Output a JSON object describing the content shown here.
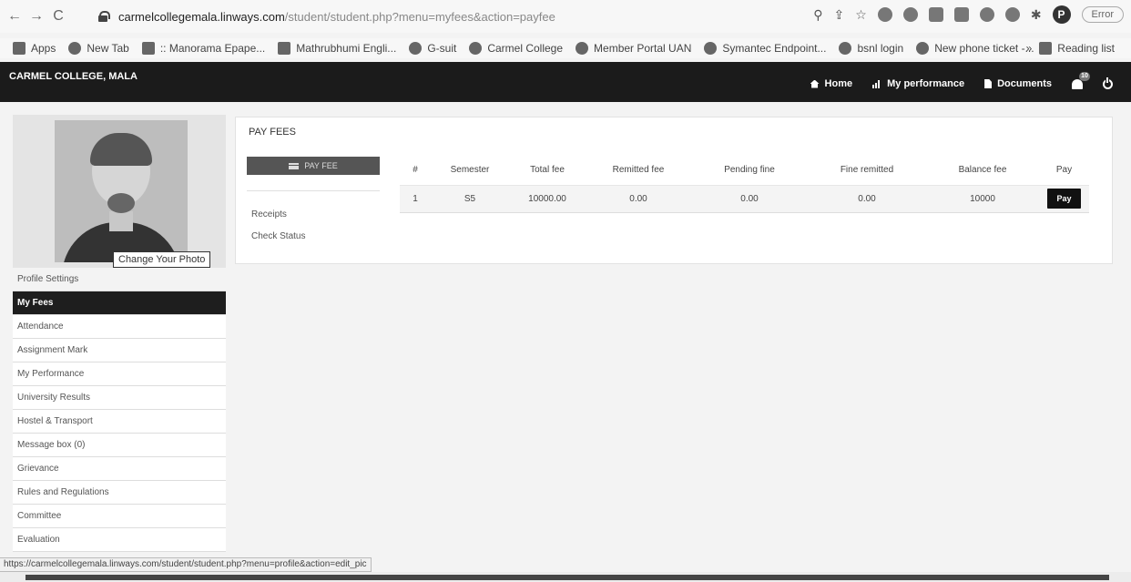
{
  "browser": {
    "url_host": "carmelcollegemala.linways.com",
    "url_path": "/student/student.php?menu=myfees&action=payfee",
    "profile_initial": "P",
    "error_label": "Error",
    "bookmarks": [
      {
        "label": "Apps",
        "icon": "apps-grid-icon"
      },
      {
        "label": "New Tab",
        "icon": "globe-icon"
      },
      {
        "label": ":: Manorama Epape...",
        "icon": "manorama-icon"
      },
      {
        "label": "Mathrubhumi Engli...",
        "icon": "mathrubhumi-icon"
      },
      {
        "label": "G-suit",
        "icon": "google-icon"
      },
      {
        "label": "Carmel College",
        "icon": "globe-icon"
      },
      {
        "label": "Member Portal UAN",
        "icon": "globe-icon"
      },
      {
        "label": "Symantec Endpoint...",
        "icon": "globe-icon"
      },
      {
        "label": "bsnl login",
        "icon": "globe-icon"
      },
      {
        "label": "New phone ticket -...",
        "icon": "star-burst-icon"
      }
    ],
    "more_label": "»",
    "reading_list_label": "Reading list",
    "status_url": "https://carmelcollegemala.linways.com/student/student.php?menu=profile&action=edit_pic"
  },
  "app": {
    "brand": "CARMEL COLLEGE, MALA",
    "nav": {
      "home": "Home",
      "performance": "My performance",
      "documents": "Documents",
      "notif_count": "10"
    }
  },
  "sidebar": {
    "change_photo": "Change Your Photo",
    "items": [
      {
        "label": "Profile Settings",
        "active": false
      },
      {
        "label": "My Fees",
        "active": true
      },
      {
        "label": "Attendance",
        "active": false
      },
      {
        "label": "Assignment Mark",
        "active": false
      },
      {
        "label": "My Performance",
        "active": false
      },
      {
        "label": "University Results",
        "active": false
      },
      {
        "label": "Hostel & Transport",
        "active": false
      },
      {
        "label": "Message box (0)",
        "active": false
      },
      {
        "label": "Grievance",
        "active": false
      },
      {
        "label": "Rules and Regulations",
        "active": false
      },
      {
        "label": "Committee",
        "active": false
      },
      {
        "label": "Evaluation",
        "active": false
      }
    ]
  },
  "main": {
    "title": "PAY FEES",
    "payfee_button": "PAY FEE",
    "links": {
      "receipts": "Receipts",
      "check_status": "Check Status"
    },
    "table": {
      "headers": [
        "#",
        "Semester",
        "Total fee",
        "Remitted fee",
        "Pending fine",
        "Fine remitted",
        "Balance fee",
        "Pay"
      ],
      "rows": [
        {
          "num": "1",
          "semester": "S5",
          "total": "10000.00",
          "remitted": "0.00",
          "pending_fine": "0.00",
          "fine_remitted": "0.00",
          "balance": "10000",
          "pay": "Pay"
        }
      ]
    }
  }
}
